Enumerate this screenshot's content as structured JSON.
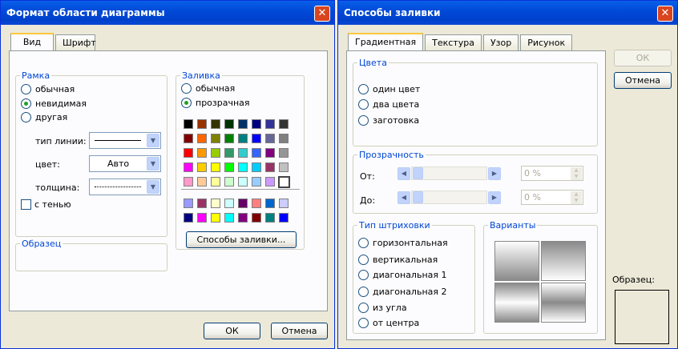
{
  "format_dialog": {
    "title": "Формат области диаграммы",
    "close_glyph": "✕",
    "tabs": [
      "Вид",
      "Шрифт"
    ],
    "border": {
      "title": "Рамка",
      "options": [
        "обычная",
        "невидимая",
        "другая"
      ],
      "selected": "невидимая",
      "line_type_label": "тип линии:",
      "color_label": "цвет:",
      "color_value": "Авто",
      "weight_label": "толщина:",
      "shadow_label": "с тенью"
    },
    "fill": {
      "title": "Заливка",
      "options": [
        "обычная",
        "прозрачная"
      ],
      "selected": "прозрачная",
      "palette": [
        [
          "#000000",
          "#993300",
          "#333300",
          "#003300",
          "#003366",
          "#000080",
          "#333399",
          "#333333"
        ],
        [
          "#800000",
          "#ff6600",
          "#808000",
          "#008000",
          "#008080",
          "#0000ff",
          "#666699",
          "#808080"
        ],
        [
          "#ff0000",
          "#ff9900",
          "#99cc00",
          "#339966",
          "#33cccc",
          "#3366ff",
          "#800080",
          "#969696"
        ],
        [
          "#ff00ff",
          "#ffcc00",
          "#ffff00",
          "#00ff00",
          "#00ffff",
          "#00ccff",
          "#993366",
          "#c0c0c0"
        ],
        [
          "#ff99cc",
          "#ffcc99",
          "#ffff99",
          "#ccffcc",
          "#ccffff",
          "#99ccff",
          "#cc99ff",
          "#ffffff"
        ],
        [
          "#9999ff",
          "#993366",
          "#ffffcc",
          "#ccffff",
          "#660066",
          "#ff8080",
          "#0066cc",
          "#ccccff"
        ],
        [
          "#000080",
          "#ff00ff",
          "#ffff00",
          "#00ffff",
          "#800080",
          "#800000",
          "#008080",
          "#0000ff"
        ]
      ],
      "fill_effects_button": "Способы заливки..."
    },
    "sample_title": "Образец",
    "ok": "ОК",
    "cancel": "Отмена"
  },
  "fill_effects_dialog": {
    "title": "Способы заливки",
    "close_glyph": "✕",
    "tabs": [
      "Градиентная",
      "Текстура",
      "Узор",
      "Рисунок"
    ],
    "colors": {
      "title": "Цвета",
      "options": [
        "один цвет",
        "два цвета",
        "заготовка"
      ]
    },
    "transparency": {
      "title": "Прозрачность",
      "from_label": "От:",
      "to_label": "До:",
      "from_value": "0 %",
      "to_value": "0 %"
    },
    "hatch": {
      "title": "Тип штриховки",
      "options": [
        "горизонтальная",
        "вертикальная",
        "диагональная 1",
        "диагональная 2",
        "из угла",
        "от центра"
      ]
    },
    "variants_title": "Варианты",
    "ok": "ОК",
    "cancel": "Отмена",
    "sample_label": "Образец:"
  }
}
